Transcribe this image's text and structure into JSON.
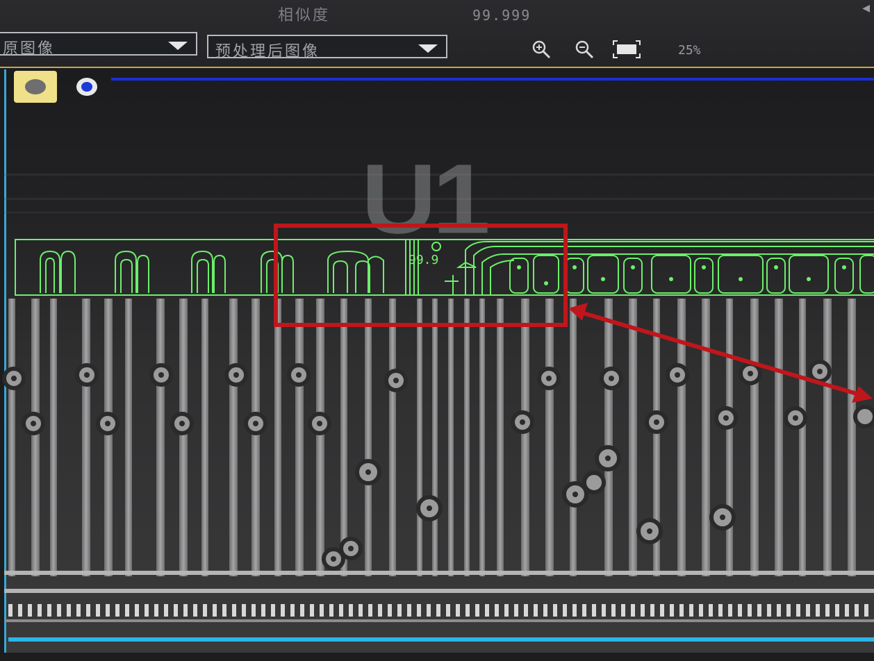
{
  "toolbar": {
    "similarity_label": "相似度",
    "similarity_value": "99.999",
    "left_select": "原图像",
    "right_select": "预处理后图像",
    "zoom_level": "25%",
    "icons": [
      "zoom-in-icon",
      "zoom-out-icon",
      "fit-window-icon",
      "chevron-down-icon"
    ]
  },
  "viewer": {
    "silkscreen_label": "U1",
    "match_score_label": "99.9",
    "tools": [
      "circle-fill-tool",
      "circle-outline-tool"
    ]
  },
  "colors": {
    "detection_outline": "#6cf06a",
    "highlight_box": "#c0161b",
    "top_rule": "#1a2fd6",
    "bottom_rule": "#29b6e8",
    "toolbar_rule": "#c9a44a"
  }
}
